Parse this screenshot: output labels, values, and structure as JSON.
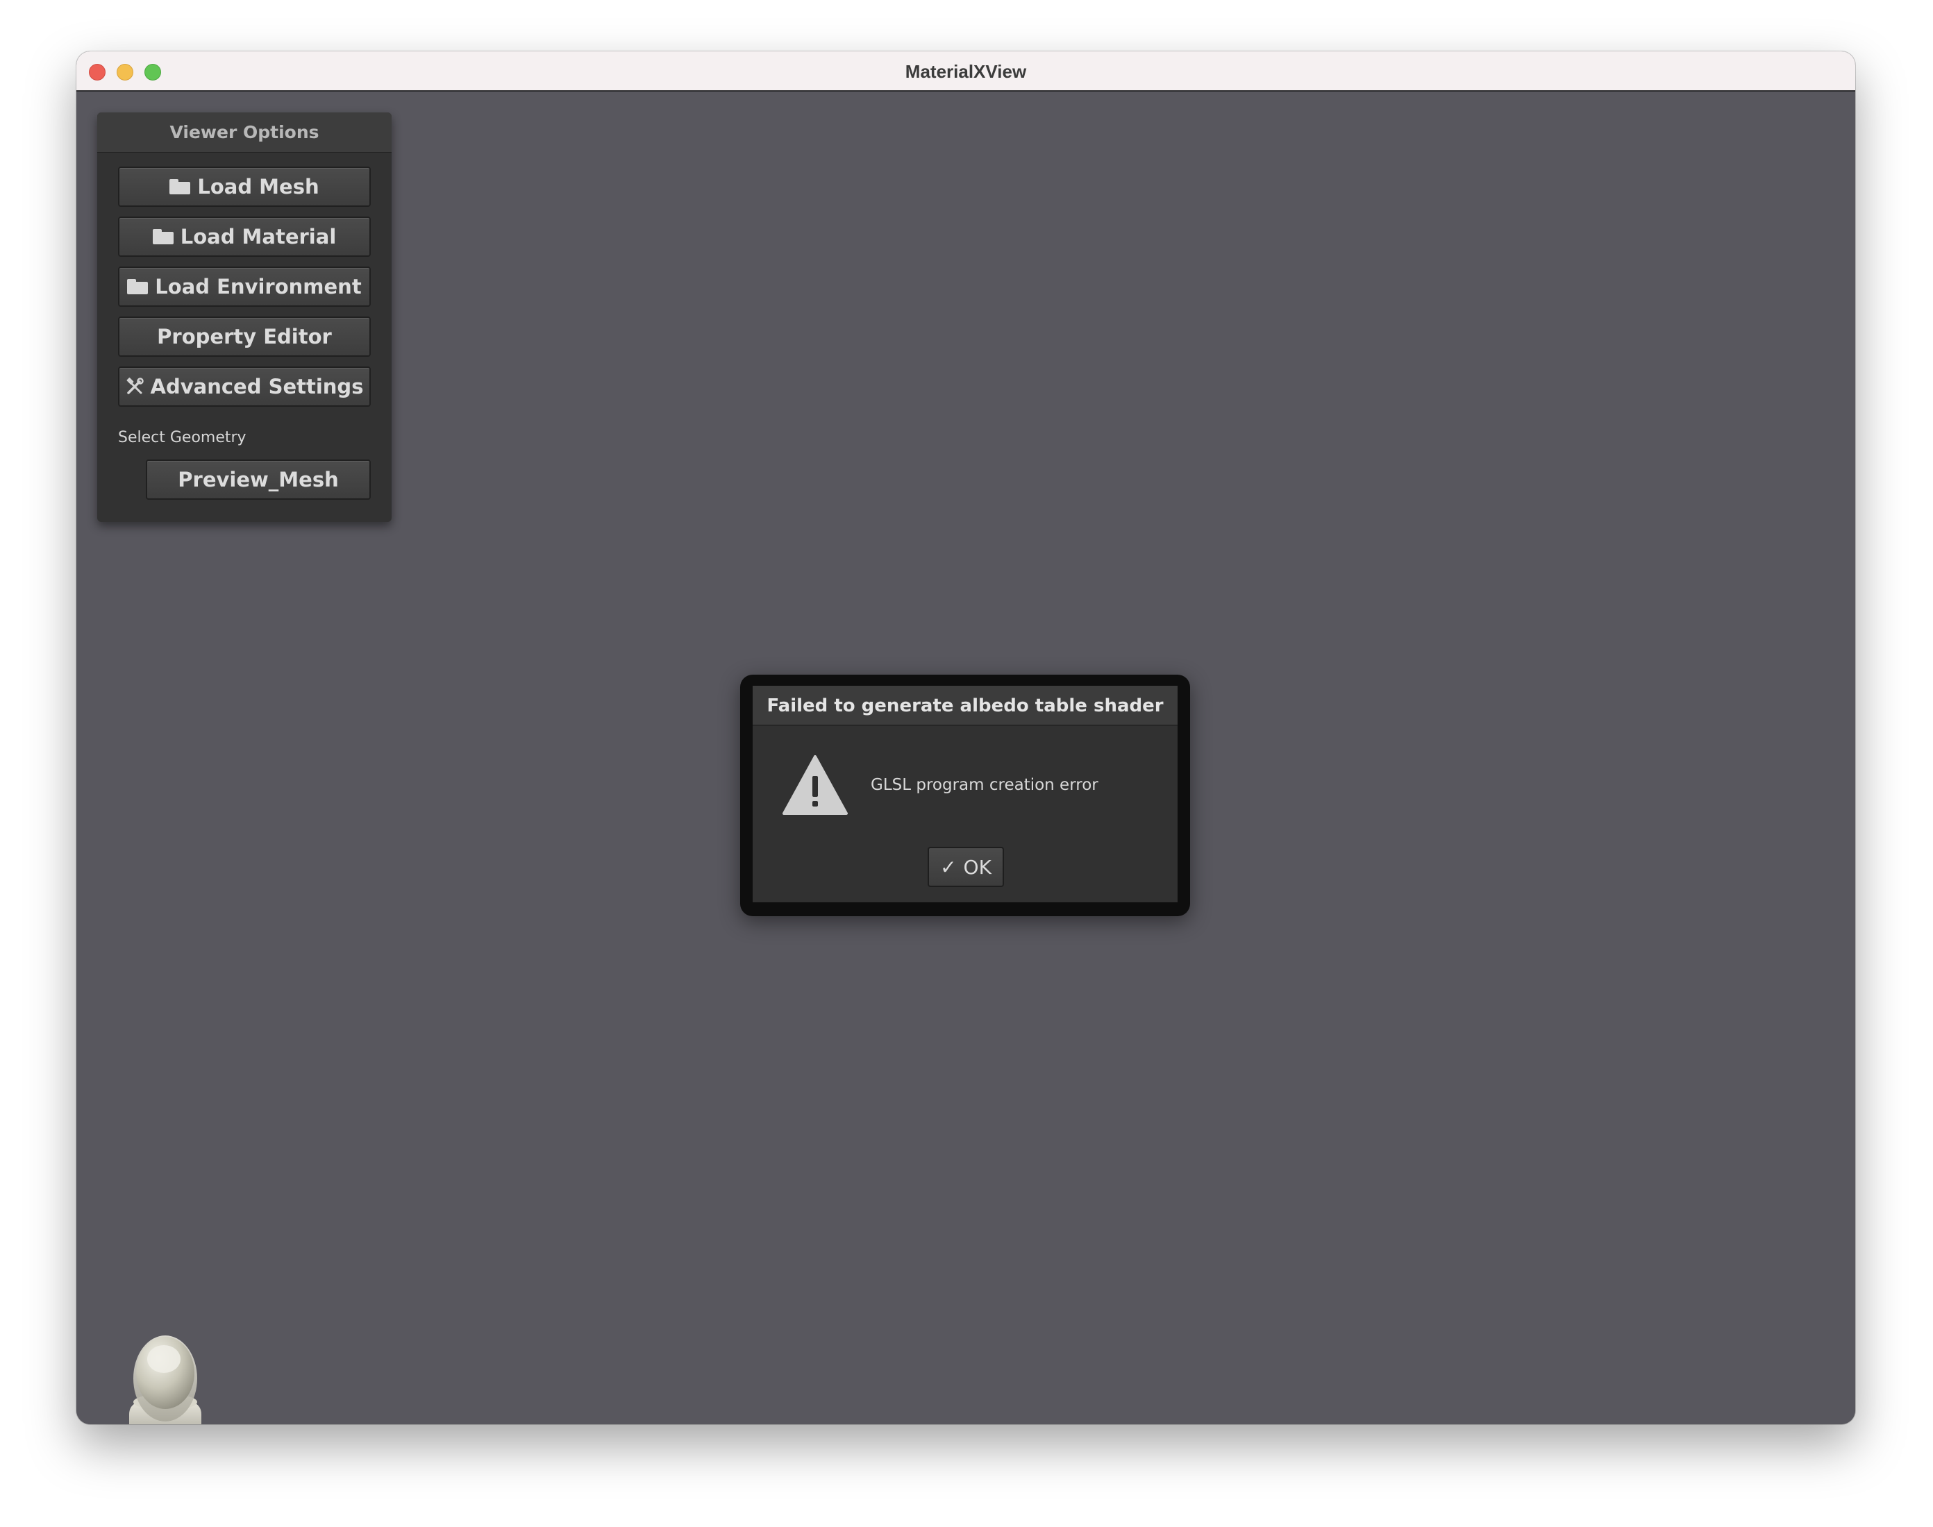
{
  "window": {
    "title": "MaterialXView"
  },
  "panel": {
    "title": "Viewer Options",
    "buttons": {
      "load_mesh": "Load Mesh",
      "load_material": "Load Material",
      "load_environment": "Load Environment",
      "property_editor": "Property Editor",
      "advanced_settings": "Advanced Settings"
    },
    "select_geometry_label": "Select Geometry",
    "geometry_selected": "Preview_Mesh"
  },
  "dialog": {
    "title": "Failed to generate albedo table shader",
    "message": "GLSL program creation error",
    "ok_label": "OK",
    "icon": "warning-icon"
  },
  "icons": {
    "load_buttons": "folder-icon",
    "advanced_settings": "tools-icon",
    "ok": "check-icon",
    "viewport_corner": "material-preview-icon"
  },
  "colors": {
    "viewport_bg": "#58575e",
    "panel_bg": "#323232",
    "dialog_bg": "#313131"
  }
}
